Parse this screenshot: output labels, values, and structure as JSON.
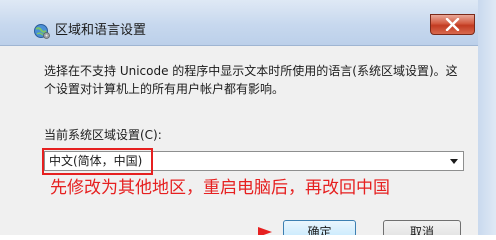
{
  "window": {
    "title": "区域和语言设置",
    "icon": "globe-settings-icon",
    "close_icon": "close-icon"
  },
  "content": {
    "description": "选择在不支持 Unicode 的程序中显示文本时所使用的语言(系统区域设置)。这个设置对计算机上的所有用户帐户都有影响。",
    "locale_label": "当前系统区域设置(C):",
    "locale_value": "中文(简体，中国)"
  },
  "annotation": {
    "text": "先修改为其他地区，重启电脑后，再改回中国",
    "color": "#e62020"
  },
  "buttons": {
    "ok_label": "确定",
    "cancel_label": "取消"
  },
  "colors": {
    "title_bar": "#c7d8ee",
    "close_button": "#c23b22",
    "highlight": "#e62020"
  }
}
